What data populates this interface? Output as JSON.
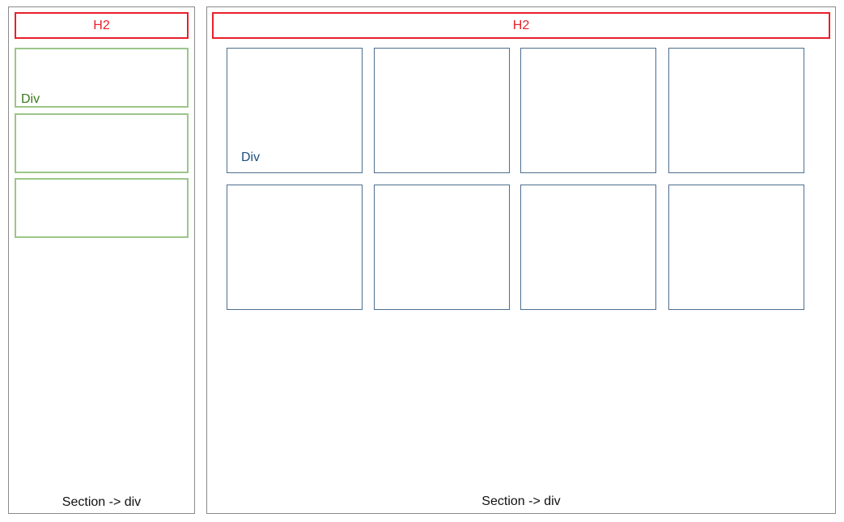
{
  "left_section": {
    "heading": "H2",
    "div_label": "Div",
    "caption": "Section -> div",
    "div_count": 3
  },
  "right_section": {
    "heading": "H2",
    "div_label": "Div",
    "caption": "Section -> div",
    "grid": {
      "rows": 2,
      "columns": 4
    }
  },
  "colors": {
    "heading": "#e8202a",
    "sidebar_div": "#9cc58a",
    "sidebar_div_label": "#3a7a1e",
    "grid_div": "#4d6e8e",
    "grid_div_label": "#1e4f80",
    "section_border": "#8a8a8a"
  }
}
